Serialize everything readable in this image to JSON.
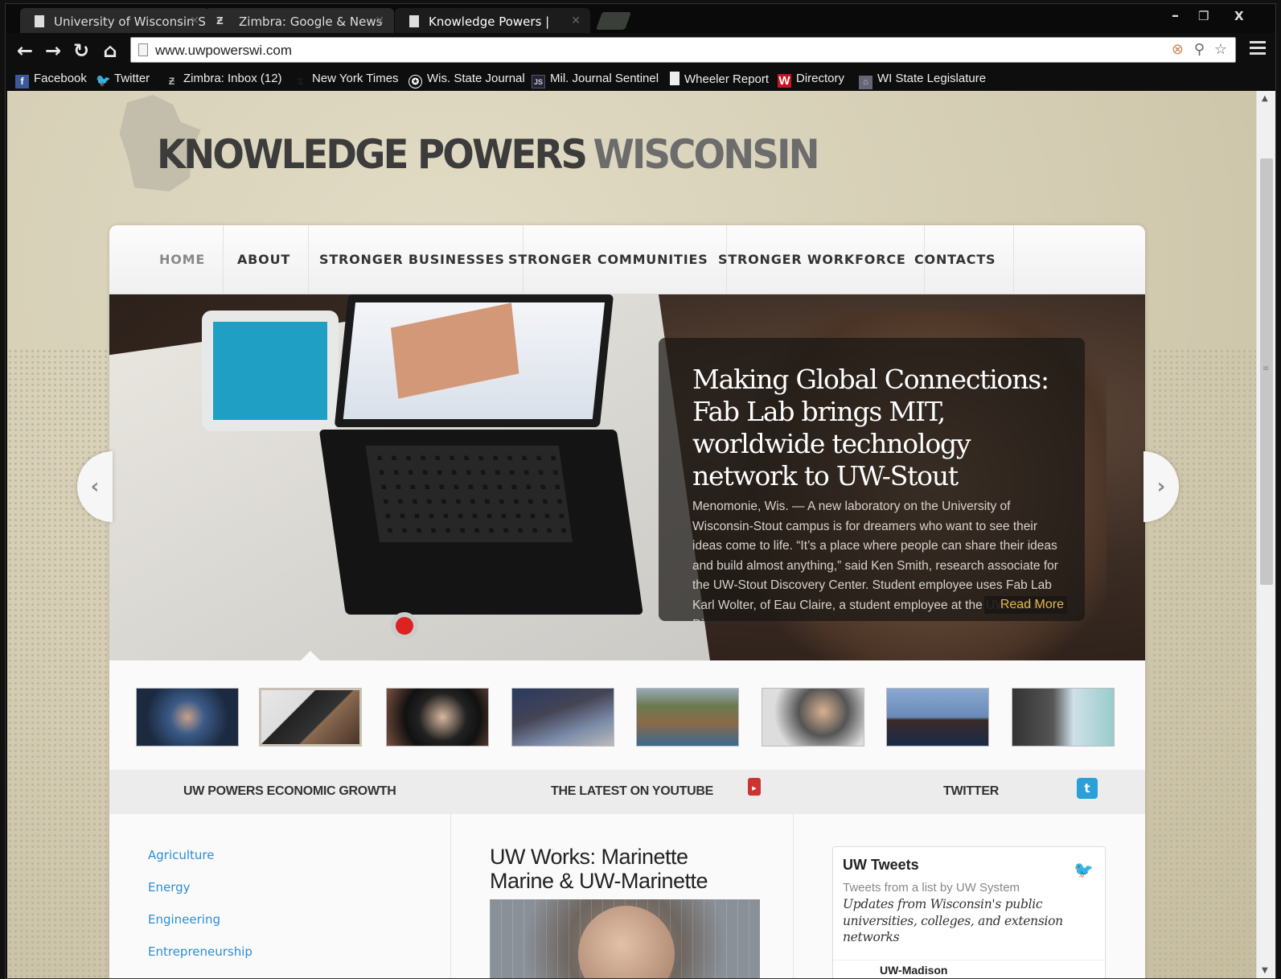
{
  "browser": {
    "tabs": [
      {
        "title": "University of Wisconsin Sy",
        "active": false
      },
      {
        "title": "Zimbra: Google & News",
        "active": false
      },
      {
        "title": "Knowledge Powers |",
        "active": true
      }
    ],
    "window_controls": {
      "minimize": "–",
      "restore": "❐",
      "close": "X"
    },
    "nav": {
      "back": "←",
      "forward": "→",
      "reload": "↻",
      "home": "⌂"
    },
    "address_bar": {
      "url": "www.uwpowerswi.com"
    },
    "bookmarks": [
      {
        "label": "Facebook",
        "icon": "facebook-icon"
      },
      {
        "label": "Twitter",
        "icon": "twitter-icon"
      },
      {
        "label": "Zimbra: Inbox (12)",
        "icon": "zimbra-icon"
      },
      {
        "label": "New York Times",
        "icon": "nyt-icon"
      },
      {
        "label": "Wis. State Journal",
        "icon": "wsj-icon"
      },
      {
        "label": "Mil. Journal Sentinel",
        "icon": "js-icon"
      },
      {
        "label": "Wheeler Report",
        "icon": "page-icon"
      },
      {
        "label": "Directory",
        "icon": "w-icon"
      },
      {
        "label": "WI State Legislature",
        "icon": "capitol-icon"
      }
    ]
  },
  "site": {
    "title_main": "KNOWLEDGE POWERS",
    "title_accent": "WISCONSIN",
    "nav": [
      {
        "label": "HOME",
        "active": true
      },
      {
        "label": "ABOUT"
      },
      {
        "label": "STRONGER BUSINESSES"
      },
      {
        "label": "STRONGER COMMUNITIES"
      },
      {
        "label": "STRONGER WORKFORCE"
      },
      {
        "label": "CONTACTS"
      }
    ],
    "slider": {
      "headline": "Making Global Connections: Fab Lab brings MIT, worldwide technology network to UW-Stout",
      "body": "Menomonie, Wis. — A new laboratory on the University of Wisconsin-Stout campus is for dreamers who want to see their ideas come to life. “It’s a place where people can share their ideas and build almost anything,” said Ken Smith, research associate for the UW-Stout Discovery Center. Student employee uses Fab Lab Karl Wolter, of Eau Claire, a student employee at the UW-Stout Discovery...",
      "read_more": "Read More",
      "prev": "‹",
      "next": "›",
      "thumbnails": 8,
      "active_thumbnail": 2
    },
    "sections": {
      "growth": "UW POWERS ECONOMIC GROWTH",
      "youtube": "THE LATEST ON YOUTUBE",
      "twitter": "TWITTER"
    },
    "categories": [
      "Agriculture",
      "Energy",
      "Engineering",
      "Entrepreneurship"
    ],
    "youtube_video": {
      "title": "UW Works: Marinette Marine & UW-Marinette"
    },
    "twitter_widget": {
      "heading": "UW Tweets",
      "subheading": "Tweets from a list by UW System",
      "description": "Updates from Wisconsin's public universities, colleges, and extension networks",
      "next_account": "UW-Madison"
    }
  }
}
